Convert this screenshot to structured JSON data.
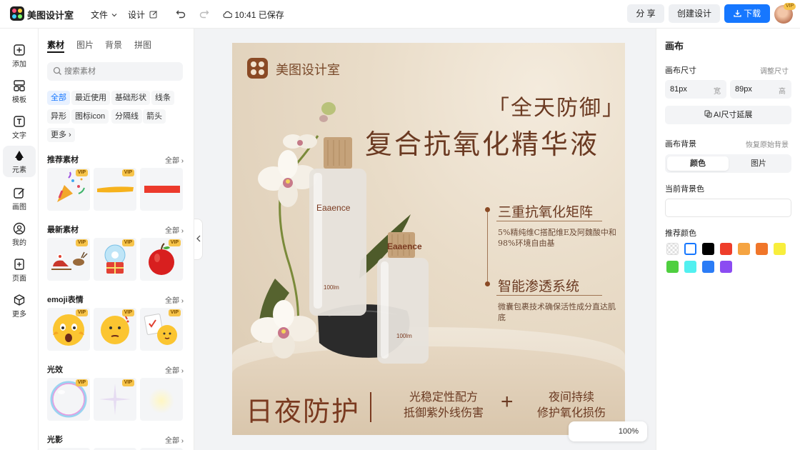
{
  "app": {
    "name": "美图设计室"
  },
  "topbar": {
    "file_menu": "文件",
    "design_menu": "设计",
    "save_status": "10:41 已保存",
    "share_label": "分 享",
    "create_label": "创建设计",
    "download_label": "下载",
    "avatar_badge": "VIP"
  },
  "rail": {
    "items": [
      {
        "label": "添加"
      },
      {
        "label": "模板"
      },
      {
        "label": "文字"
      },
      {
        "label": "元素"
      },
      {
        "label": "画图"
      },
      {
        "label": "我的"
      },
      {
        "label": "页面"
      },
      {
        "label": "更多"
      }
    ]
  },
  "panel": {
    "tabs": [
      {
        "label": "素材"
      },
      {
        "label": "图片"
      },
      {
        "label": "背景"
      },
      {
        "label": "拼图"
      }
    ],
    "search_placeholder": "搜索素材",
    "chips": [
      {
        "label": "全部"
      },
      {
        "label": "最近使用"
      },
      {
        "label": "基础形状"
      },
      {
        "label": "线条"
      },
      {
        "label": "异形"
      },
      {
        "label": "图标icon"
      },
      {
        "label": "分隔线"
      },
      {
        "label": "箭头"
      },
      {
        "label": "更多 ›"
      }
    ],
    "vip_badge": "VIP",
    "all_label": "全部 ›",
    "sections": [
      {
        "title": "推荐素材"
      },
      {
        "title": "最新素材"
      },
      {
        "title": "emoji表情"
      },
      {
        "title": "光效"
      },
      {
        "title": "光影"
      }
    ]
  },
  "poster": {
    "brand": "美图设计室",
    "headline_1": "「全天防御」",
    "headline_2": "复合抗氧化精华液",
    "bottle_label": "Eaaence",
    "bottle_volume": "100lm",
    "feature_1_title": "三重抗氧化矩阵",
    "feature_1_desc": "5%精纯维C搭配维E及阿魏酸中和98%环境自由基",
    "feature_2_title": "智能渗透系统",
    "feature_2_desc": "微囊包裹技术确保活性成分直达肌底",
    "bottom_main": "日夜防护",
    "bottom_left_1": "光稳定性配方",
    "bottom_left_2": "抵御紫外线伤害",
    "bottom_plus": "+",
    "bottom_right_1": "夜间持续",
    "bottom_right_2": "修护氧化损伤"
  },
  "zoom": {
    "value": "100%"
  },
  "right_panel": {
    "title": "画布",
    "size_label": "画布尺寸",
    "resize_link": "调整尺寸",
    "width_value": "81px",
    "width_unit": "宽",
    "height_value": "89px",
    "height_unit": "高",
    "ai_extend_label": "AI尺寸延展",
    "bg_label": "画布背景",
    "restore_link": "恢复原始背景",
    "seg_color": "颜色",
    "seg_image": "图片",
    "current_bg_label": "当前背景色",
    "recommend_label": "推荐颜色",
    "swatches": [
      "transparent",
      "#ffffff",
      "#000000",
      "#ee3d2a",
      "#f5a442",
      "#f0762a",
      "#f8ee3c",
      "#4fcf3f",
      "#52f0f0",
      "#2b7cf6",
      "#8b4cf2"
    ]
  },
  "colors": {
    "accent": "#1677ff",
    "poster_text": "#6b3a22"
  }
}
